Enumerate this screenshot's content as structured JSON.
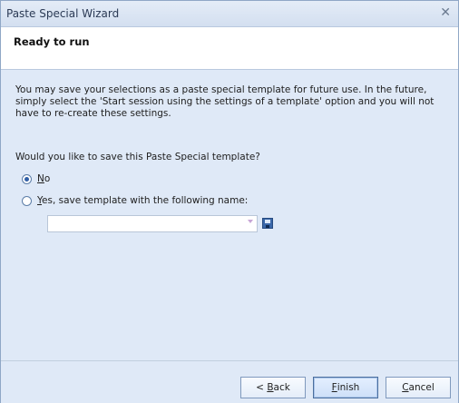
{
  "window": {
    "title": "Paste Special Wizard",
    "close_label": "✕"
  },
  "header": {
    "title": "Ready to run"
  },
  "main": {
    "info_text": "You may save your selections as a paste special template for future use.  In the future, simply select the 'Start session using the settings of a template' option and you will not have to re-create these settings.",
    "question": "Would you like to save this Paste Special template?",
    "options": {
      "no_label_u": "N",
      "no_label_rest": "o",
      "yes_label_u": "Y",
      "yes_label_rest": "es, save template with the following name:"
    },
    "selected_option": "No",
    "template_name_value": ""
  },
  "footer": {
    "back_prefix": "< ",
    "back_u": "B",
    "back_rest": "ack",
    "finish_u": "F",
    "finish_rest": "inish",
    "cancel_u": "C",
    "cancel_rest": "ancel"
  },
  "icons": {
    "close": "close-icon",
    "save": "save-icon",
    "dropdown": "chevron-down-icon"
  },
  "colors": {
    "window_bg": "#dfe9f7",
    "title_text": "#2b3a55",
    "accent_radio": "#2f5ea6"
  }
}
